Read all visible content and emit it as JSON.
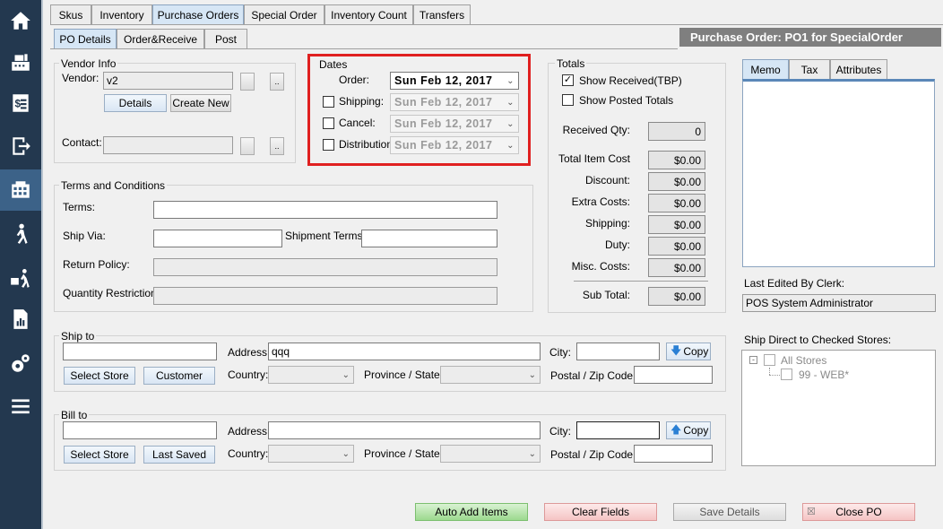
{
  "nav": {
    "items": [
      "home-icon",
      "cash-register-icon",
      "receipt-icon",
      "logout-icon",
      "inventory-icon",
      "customers-icon",
      "delivery-icon",
      "reports-icon",
      "settings-icon",
      "menu-icon"
    ]
  },
  "tabs_top": [
    "Skus",
    "Inventory",
    "Purchase Orders",
    "Special Order",
    "Inventory Count",
    "Transfers"
  ],
  "tabs_sub": [
    "PO Details",
    "Order&Receive",
    "Post"
  ],
  "header": {
    "title": "Purchase Order:  PO1 for SpecialOrder"
  },
  "vendor_info": {
    "title": "Vendor Info",
    "vendor_label": "Vendor:",
    "vendor_value": "v2",
    "details_btn": "Details",
    "create_new_btn": "Create New",
    "contact_label": "Contact:",
    "contact_value": "",
    "small_btn": ".."
  },
  "dates": {
    "title": "Dates",
    "order_label": "Order:",
    "order_value": "Sun  Feb  12, 2017",
    "shipping_label": "Shipping:",
    "shipping_value": "Sun  Feb  12, 2017",
    "cancel_label": "Cancel:",
    "cancel_value": "Sun  Feb  12, 2017",
    "distribution_label": "Distribution:",
    "distribution_value": "Sun  Feb  12, 2017"
  },
  "totals": {
    "title": "Totals",
    "show_received": "Show Received(TBP)",
    "show_received_checked": true,
    "show_posted": "Show Posted Totals",
    "received_qty_label": "Received Qty:",
    "received_qty": "0",
    "total_item_cost_label": "Total Item Cost",
    "total_item_cost": "$0.00",
    "discount_label": "Discount:",
    "discount": "$0.00",
    "extra_costs_label": "Extra Costs:",
    "extra_costs": "$0.00",
    "shipping_label": "Shipping:",
    "shipping": "$0.00",
    "duty_label": "Duty:",
    "duty": "$0.00",
    "misc_label": "Misc. Costs:",
    "misc": "$0.00",
    "subtotal_label": "Sub Total:",
    "subtotal": "$0.00"
  },
  "right_tabs": [
    "Memo",
    "Tax",
    "Attributes"
  ],
  "last_edited": {
    "label": "Last Edited By Clerk:",
    "value": "POS System Administrator"
  },
  "ship_direct": {
    "label": "Ship Direct to Checked Stores:",
    "root": "All Stores",
    "child": "99 - WEB*"
  },
  "terms": {
    "title": "Terms and Conditions",
    "terms_label": "Terms:",
    "ship_via_label": "Ship Via:",
    "shipment_terms_label": "Shipment Terms:",
    "return_policy_label": "Return Policy:",
    "qty_restriction_label": "Quantity Restriction:"
  },
  "ship_to": {
    "title": "Ship to",
    "address_label": "Address:",
    "address_value": "qqq",
    "city_label": "City:",
    "copy_btn": "Copy",
    "select_store_btn": "Select Store",
    "customer_btn": "Customer",
    "country_label": "Country:",
    "province_label": "Province / State:",
    "postal_label": "Postal / Zip Code:"
  },
  "bill_to": {
    "title": "Bill to",
    "address_label": "Address:",
    "city_label": "City:",
    "copy_btn": "Copy",
    "select_store_btn": "Select Store",
    "last_saved_btn": "Last Saved",
    "country_label": "Country:",
    "province_label": "Province / State:",
    "postal_label": "Postal / Zip Code:"
  },
  "footer": {
    "auto_add": "Auto Add Items",
    "clear": "Clear Fields",
    "save": "Save Details",
    "close": "Close PO"
  }
}
